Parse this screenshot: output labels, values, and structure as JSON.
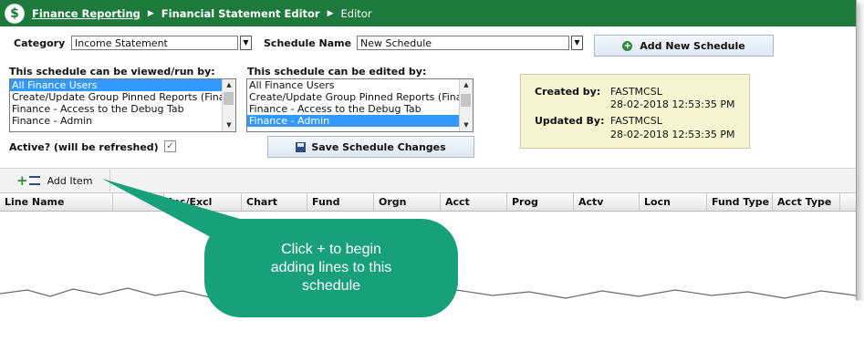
{
  "breadcrumb": {
    "items": [
      "Finance Reporting",
      "Financial Statement Editor",
      "Editor"
    ]
  },
  "form": {
    "category_label": "Category",
    "category_value": "Income Statement",
    "schedule_name_label": "Schedule Name",
    "schedule_name_value": "New Schedule",
    "add_schedule_button": "Add New Schedule",
    "viewed_label": "This schedule can be viewed/run by:",
    "viewed_options": [
      "All Finance Users",
      "Create/Update Group Pinned Reports (Fina",
      "Finance - Access to the Debug Tab",
      "Finance - Admin"
    ],
    "edited_label": "This schedule can be edited by:",
    "edited_options": [
      "All Finance Users",
      "Create/Update Group Pinned Reports (Fina",
      "Finance - Access to the Debug Tab",
      "Finance - Admin"
    ],
    "active_label": "Active? (will be refreshed)",
    "save_button": "Save Schedule Changes"
  },
  "info": {
    "created_label": "Created by:",
    "created_user": "FASTMCSL",
    "created_date": "28-02-2018 12:53:35 PM",
    "updated_label": "Updated By:",
    "updated_user": "FASTMCSL",
    "updated_date": "28-02-2018 12:53:35 PM"
  },
  "toolbar": {
    "add_item": "Add Item"
  },
  "grid": {
    "columns": [
      "Line Name",
      "",
      "Inc/Excl",
      "Chart",
      "Fund",
      "Orgn",
      "Acct",
      "Prog",
      "Actv",
      "Locn",
      "Fund Type",
      "Acct Type"
    ]
  },
  "callout": {
    "line1": "Click + to begin",
    "line2": "adding lines to this",
    "line3": "schedule"
  },
  "colors": {
    "titlebar": "#1d7a3c",
    "selection": "#3399ff",
    "callout": "#17a07a",
    "infobox": "#f7f4d2"
  }
}
